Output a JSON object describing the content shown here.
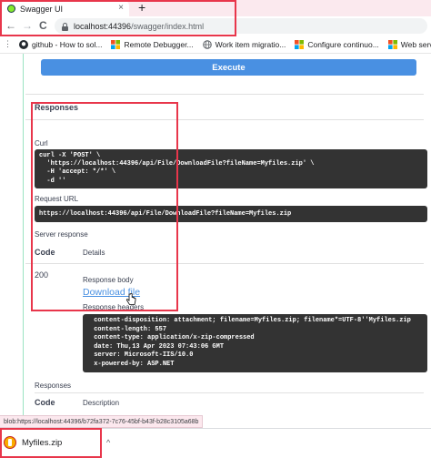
{
  "browser": {
    "tab_title": "Swagger UI",
    "tab_close": "×",
    "new_tab": "+",
    "back": "←",
    "forward": "→",
    "reload": "C",
    "url_host": "localhost:44396",
    "url_path": "/swagger/index.html"
  },
  "bookmarks": [
    {
      "label": "github - How to sol...",
      "icon": "github-icon"
    },
    {
      "label": "Remote Debugger...",
      "icon": "windows-icon"
    },
    {
      "label": "Work item migratio...",
      "icon": "globe-icon"
    },
    {
      "label": "Configure continuo...",
      "icon": "windows-icon"
    },
    {
      "label": "Web service error c...",
      "icon": "windows-icon"
    }
  ],
  "swagger": {
    "execute_label": "Execute",
    "responses_title": "Responses",
    "curl_label": "Curl",
    "curl_lines": [
      "curl -X 'POST' \\",
      "  'https://localhost:44396/api/File/DownloadFile?fileName=Myfiles.zip' \\",
      "  -H 'accept: */*' \\",
      "  -d ''"
    ],
    "request_url_label": "Request URL",
    "request_url": "https://localhost:44396/api/File/DownloadFile?fileName=Myfiles.zip",
    "server_response_label": "Server response",
    "code_header": "Code",
    "details_header": "Details",
    "status_code": "200",
    "response_body_label": "Response body",
    "download_link": "Download file",
    "response_headers_label": "Response headers",
    "response_headers": [
      " content-disposition: attachment; filename=Myfiles.zip; filename*=UTF-8''Myfiles.zip",
      " content-length: 557",
      " content-type: application/x-zip-compressed",
      " date: Thu,13 Apr 2023 07:43:06 GMT",
      " server: Microsoft-IIS/10.0",
      " x-powered-by: ASP.NET"
    ],
    "responses_title_2": "Responses",
    "code_header_2": "Code",
    "description_header": "Description"
  },
  "status_bar": {
    "url": "blob:https://localhost:44396/b72fa372-7c76-45bf-b43f-b28c3105a68b"
  },
  "downloads": {
    "file_name": "Myfiles.zip",
    "chevron": "^"
  },
  "colors": {
    "execute": "#4990e2",
    "highlight_box": "#e8364b",
    "code_background": "#333333",
    "link": "#4990e2"
  }
}
